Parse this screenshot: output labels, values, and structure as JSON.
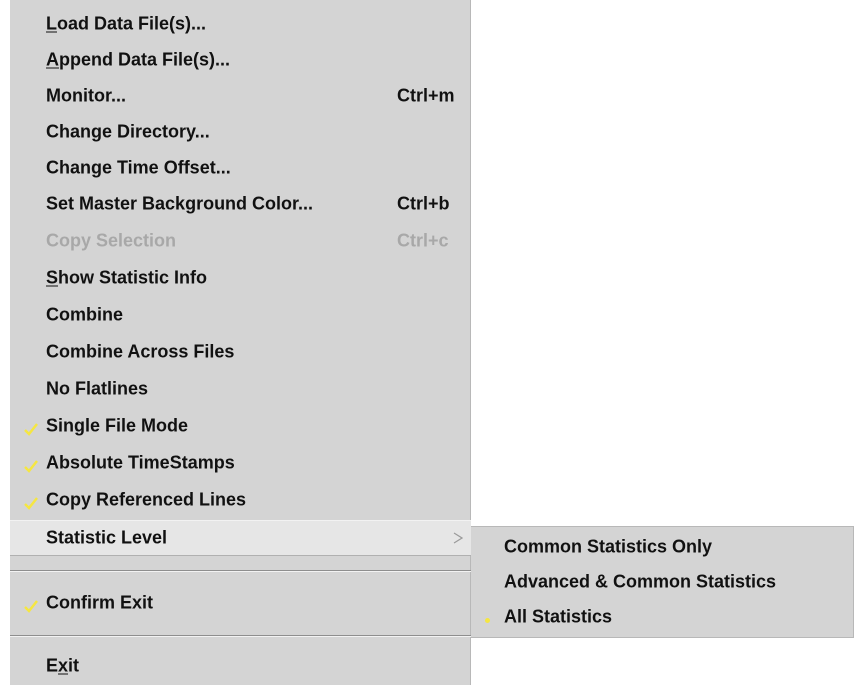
{
  "menu": {
    "items": [
      {
        "label_pre": "",
        "mnemonic": "L",
        "label_post": "oad Data File(s)...",
        "shortcut": ""
      },
      {
        "label_pre": "",
        "mnemonic": "A",
        "label_post": "ppend Data File(s)...",
        "shortcut": ""
      },
      {
        "label_pre": "Monitor...",
        "mnemonic": "",
        "label_post": "",
        "shortcut": "Ctrl+m"
      },
      {
        "label_pre": "Change Directory...",
        "mnemonic": "",
        "label_post": "",
        "shortcut": ""
      },
      {
        "label_pre": "Change Time Offset...",
        "mnemonic": "",
        "label_post": "",
        "shortcut": ""
      },
      {
        "label_pre": "Set Master Background Color...",
        "mnemonic": "",
        "label_post": "",
        "shortcut": "Ctrl+b"
      },
      {
        "label_pre": "Copy Selection",
        "mnemonic": "",
        "label_post": "",
        "shortcut": "Ctrl+c"
      },
      {
        "label_pre": "",
        "mnemonic": "S",
        "label_post": "how Statistic Info",
        "shortcut": ""
      },
      {
        "label_pre": "Combine",
        "mnemonic": "",
        "label_post": "",
        "shortcut": ""
      },
      {
        "label_pre": "Combine Across Files",
        "mnemonic": "",
        "label_post": "",
        "shortcut": ""
      },
      {
        "label_pre": "No Flatlines",
        "mnemonic": "",
        "label_post": "",
        "shortcut": ""
      },
      {
        "label_pre": "Single File Mode",
        "mnemonic": "",
        "label_post": "",
        "shortcut": ""
      },
      {
        "label_pre": "Absolute TimeStamps",
        "mnemonic": "",
        "label_post": "",
        "shortcut": ""
      },
      {
        "label_pre": "Copy Referenced Lines",
        "mnemonic": "",
        "label_post": "",
        "shortcut": ""
      },
      {
        "label_pre": "Statistic Level",
        "mnemonic": "",
        "label_post": "",
        "shortcut": ""
      },
      {
        "label_pre": "Confirm Exit",
        "mnemonic": "",
        "label_post": "",
        "shortcut": ""
      },
      {
        "label_pre": "E",
        "mnemonic": "x",
        "label_post": "it",
        "shortcut": ""
      }
    ],
    "disabled_item": "Copy Selection",
    "checked_items": [
      "Single File Mode",
      "Absolute TimeStamps",
      "Copy Referenced Lines",
      "Confirm Exit"
    ],
    "open_submenu_item": "Statistic Level"
  },
  "submenu": {
    "items": [
      {
        "label": "Common Statistics Only"
      },
      {
        "label": "Advanced & Common Statistics"
      },
      {
        "label": "All Statistics"
      }
    ],
    "selected_item": "All Statistics"
  },
  "colors": {
    "menu_bg": "#d4d4d4",
    "highlight_bg": "#e6e6e6",
    "text": "#111111",
    "disabled_text": "#a8a8a8",
    "check_mark": "#f5e642",
    "selected_dot": "#f5e642"
  },
  "icons": {
    "check": "check-icon",
    "submenu_arrow": "chevron-right-icon",
    "radio": "radio-dot-icon"
  }
}
